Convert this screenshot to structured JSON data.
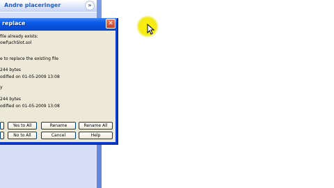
{
  "taskpane": {
    "title": "Andre placeringer",
    "toggle_icon": "chevron-double-down-icon"
  },
  "dialog": {
    "title": "replace",
    "close_icon": "close-icon",
    "messages": [
      "file already exists:",
      "owf\\achSlot.sol",
      "e to replace the existing file",
      "244 bytes",
      "odified on 01-05-2009 13:08",
      "y",
      "244 bytes",
      "odified on 01-05-2009 13:08"
    ],
    "buttons_row1": [
      "Yes to All",
      "Rename",
      "Rename All"
    ],
    "buttons_row2": [
      "No to All",
      "Cancel",
      "Help"
    ]
  },
  "colors": {
    "titlebar": "#0a5ce8",
    "taskpane": "#6a8be0",
    "dialog_bg": "#ece9d8",
    "cursor_highlight": "#fff000"
  }
}
